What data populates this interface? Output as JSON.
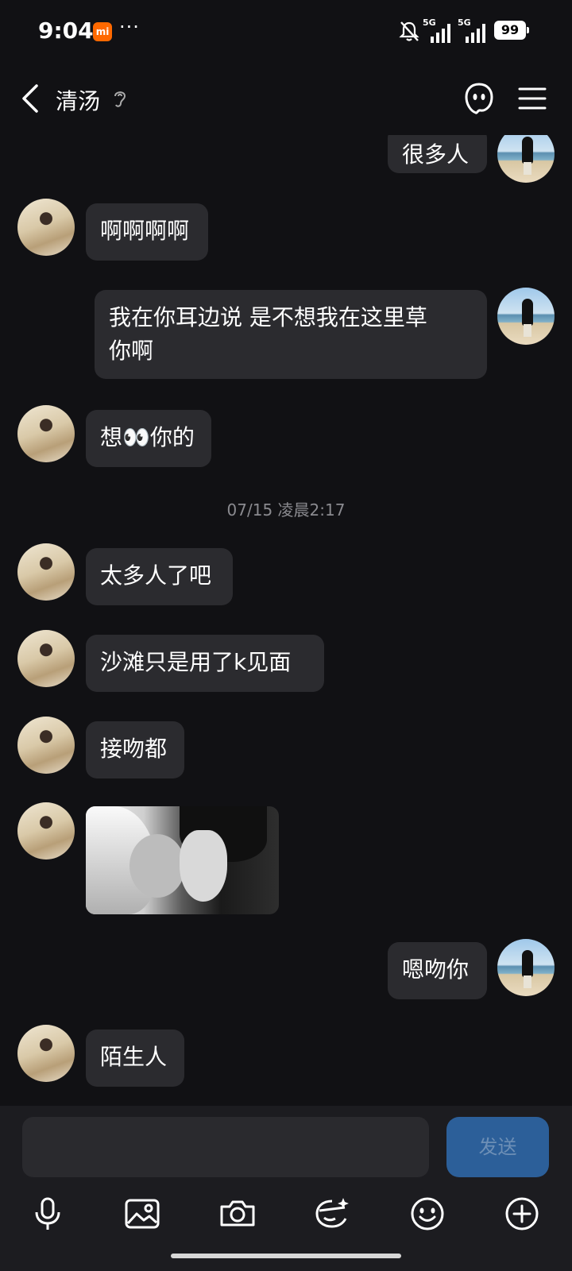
{
  "status_bar": {
    "time": "9:04",
    "app_badge": "mi",
    "dots": "···",
    "signal1_label": "5G",
    "signal2_label": "5G",
    "battery": "99"
  },
  "header": {
    "title": "清汤",
    "icons": [
      "back-icon",
      "ear-icon",
      "ghost-icon",
      "menu-icon"
    ]
  },
  "messages": [
    {
      "from": "me",
      "text": "很多人"
    },
    {
      "from": "her",
      "text": "啊啊啊啊"
    },
    {
      "from": "me",
      "text": "我在你耳边说 是不想我在这里草\n你啊"
    },
    {
      "from": "her",
      "text": "想👀你的"
    },
    {
      "type": "timestamp",
      "text": "07/15 凌晨2:17"
    },
    {
      "from": "her",
      "text": "太多人了吧"
    },
    {
      "from": "her",
      "text": "沙滩只是用了k见面"
    },
    {
      "from": "her",
      "text": "接吻都"
    },
    {
      "from": "her",
      "type": "image"
    },
    {
      "from": "me",
      "text": "嗯吻你"
    },
    {
      "from": "her",
      "text": "陌生人"
    }
  ],
  "input_bar": {
    "placeholder": "",
    "send_label": "发送",
    "tools": [
      "microphone-icon",
      "image-icon",
      "camera-icon",
      "sticker-icon",
      "emoji-icon",
      "plus-icon"
    ]
  },
  "colors": {
    "background": "#111114",
    "bubble": "#2b2b2f",
    "send_button": "#2c5f99",
    "timestamp": "#8a8a8f"
  }
}
